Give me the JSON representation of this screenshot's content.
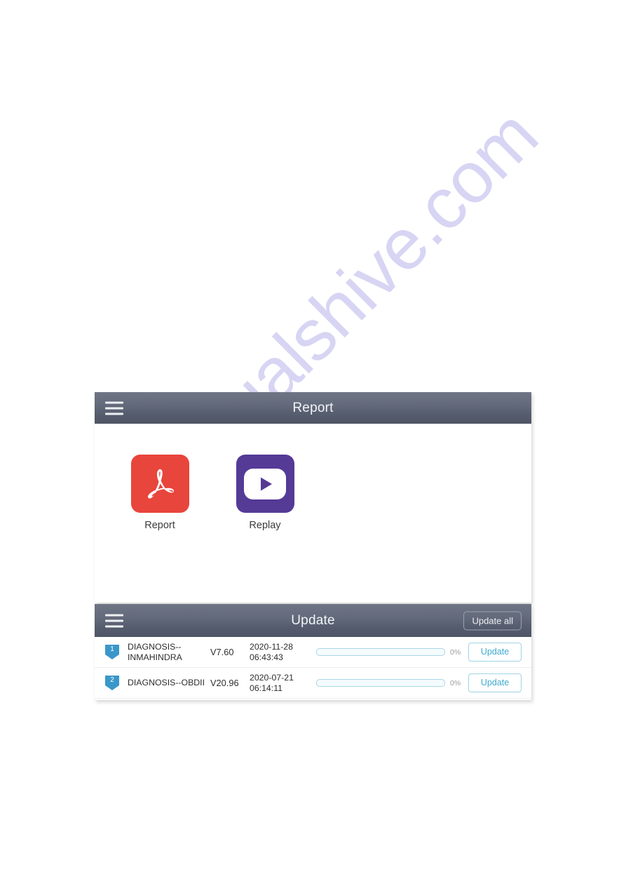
{
  "watermark": {
    "text": "manualshive.com"
  },
  "report_panel": {
    "header": {
      "title": "Report",
      "menu_icon": "hamburger-menu-icon"
    },
    "apps": [
      {
        "label": "Report",
        "icon": "pdf-icon",
        "color": "#e8453c"
      },
      {
        "label": "Replay",
        "icon": "play-video-icon",
        "color": "#553a96"
      }
    ]
  },
  "update_panel": {
    "header": {
      "title": "Update",
      "menu_icon": "hamburger-menu-icon",
      "update_all_label": "Update all"
    },
    "rows": [
      {
        "index": "1",
        "name": "DIAGNOSIS--INMAHINDRA",
        "version": "V7.60",
        "date": "2020-11-28",
        "time": "06:43:43",
        "progress": 0,
        "progress_label": "0%",
        "action_label": "Update"
      },
      {
        "index": "2",
        "name": "DIAGNOSIS--OBDII",
        "version": "V20.96",
        "date": "2020-07-21",
        "time": "06:14:11",
        "progress": 0,
        "progress_label": "0%",
        "action_label": "Update"
      }
    ]
  },
  "colors": {
    "topbar_light": "#6e7585",
    "topbar_dark": "#4e5565",
    "accent_blue": "#3ea9cd",
    "badge_blue": "#3a97c9",
    "watermark": "#c9c6ef"
  }
}
